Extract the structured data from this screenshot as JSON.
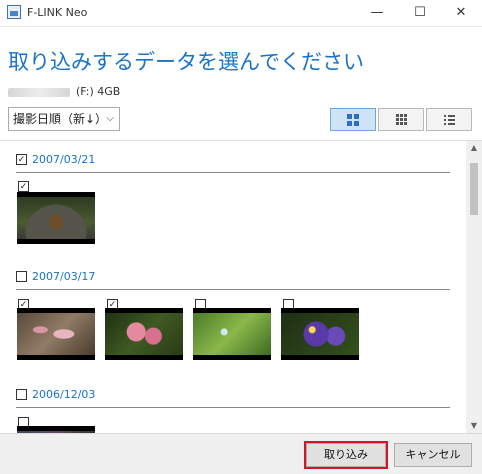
{
  "window": {
    "title": "F-LINK Neo",
    "min": "—",
    "max": "☐",
    "close": "✕"
  },
  "heading": "取り込みするデータを選んでください",
  "drive": {
    "label": "(F:) 4GB"
  },
  "sort": {
    "value": "撮影日順（新↓）",
    "chevron": "⌵"
  },
  "view_buttons": [
    {
      "icon": "large-grid-icon",
      "selected": true
    },
    {
      "icon": "small-grid-icon",
      "selected": false
    },
    {
      "icon": "list-icon",
      "selected": false
    }
  ],
  "groups": [
    {
      "date": "2007/03/21",
      "checked": true,
      "photos": [
        {
          "checked": true,
          "subject": "pinecone"
        }
      ]
    },
    {
      "date": "2007/03/17",
      "checked": false,
      "photos": [
        {
          "checked": true,
          "subject": "flower-1"
        },
        {
          "checked": true,
          "subject": "flower-2"
        },
        {
          "checked": false,
          "subject": "flower-3"
        },
        {
          "checked": false,
          "subject": "flower-4"
        }
      ]
    },
    {
      "date": "2006/12/03",
      "checked": false,
      "photos": [
        {
          "checked": false,
          "subject": "partial"
        }
      ]
    }
  ],
  "scrollbar": {
    "up": "▲",
    "down": "▼"
  },
  "buttons": {
    "import": "取り込み",
    "cancel": "キャンセル"
  },
  "colors": {
    "accent": "#1a73c8",
    "highlight_border": "#d3152b"
  }
}
